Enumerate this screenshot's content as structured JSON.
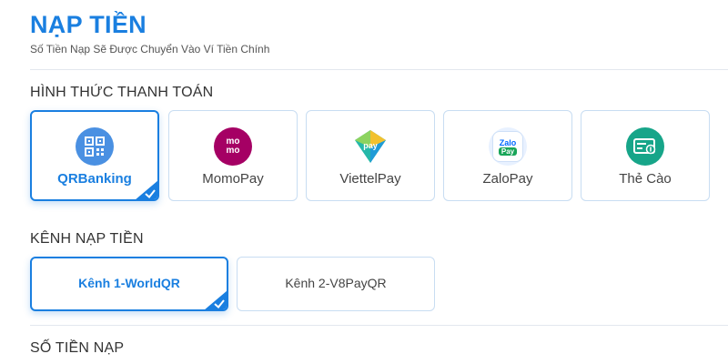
{
  "header": {
    "title": "NẠP TIỀN",
    "subtitle": "Số Tiền Nạp Sẽ Được Chuyển Vào Ví Tiền Chính"
  },
  "payment_methods": {
    "label": "HÌNH THỨC THANH TOÁN",
    "items": [
      {
        "label": "QRBanking",
        "icon": "qr-code-icon",
        "selected": true
      },
      {
        "label": "MomoPay",
        "icon": "momo-icon",
        "icon_text": "mo mo",
        "selected": false
      },
      {
        "label": "ViettelPay",
        "icon": "viettelpay-icon",
        "icon_text": "pay",
        "selected": false
      },
      {
        "label": "ZaloPay",
        "icon": "zalopay-icon",
        "icon_text_top": "Zalo",
        "icon_text_bottom": "Pay",
        "selected": false
      },
      {
        "label": "Thẻ Cào",
        "icon": "scratch-card-icon",
        "selected": false
      }
    ]
  },
  "channels": {
    "label": "KÊNH NẠP TIỀN",
    "items": [
      {
        "label": "Kênh 1-WorldQR",
        "selected": true
      },
      {
        "label": "Kênh 2-V8PayQR",
        "selected": false
      }
    ]
  },
  "amount": {
    "label": "SỐ TIỀN NẠP"
  },
  "colors": {
    "accent": "#1a7fe0",
    "momo": "#a50064",
    "zalo": "#0068ff",
    "card": "#17a589"
  }
}
